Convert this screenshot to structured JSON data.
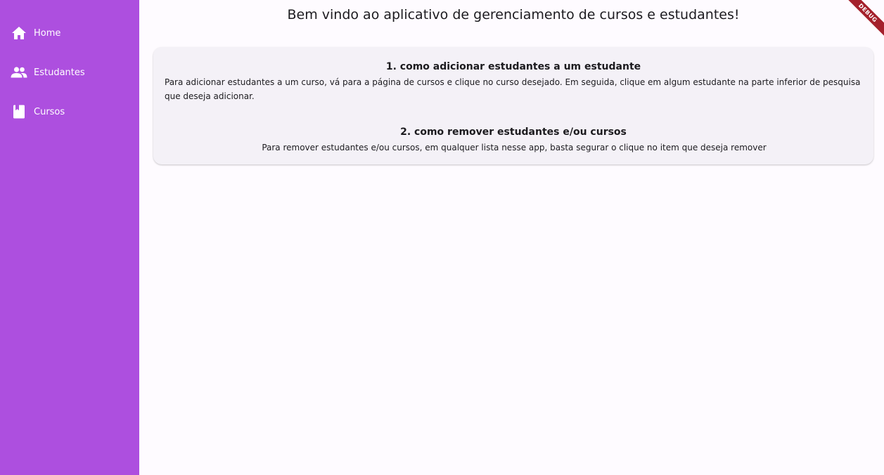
{
  "sidebar": {
    "items": [
      {
        "label": "Home",
        "icon": "home-icon"
      },
      {
        "label": "Estudantes",
        "icon": "people-icon"
      },
      {
        "label": "Cursos",
        "icon": "book-icon"
      }
    ]
  },
  "main": {
    "title": "Bem vindo ao aplicativo de gerenciamento de cursos e estudantes!",
    "sections": [
      {
        "title": "1. como adicionar estudantes a um estudante",
        "body": "Para adicionar estudantes a um curso, vá para a página de cursos e clique no curso desejado. Em seguida, clique em algum estudante na parte inferior de pesquisa que deseja adicionar."
      },
      {
        "title": "2. como remover estudantes e/ou cursos",
        "body": "Para remover estudantes e/ou cursos, em qualquer lista nesse app, basta segurar o clique no item que deseja remover"
      }
    ]
  },
  "debug_banner": "DEBUG",
  "colors": {
    "sidebar": "#ad4fdf",
    "background": "#fefbff",
    "card": "#f4f1f7",
    "debug_banner": "#a4212c"
  }
}
